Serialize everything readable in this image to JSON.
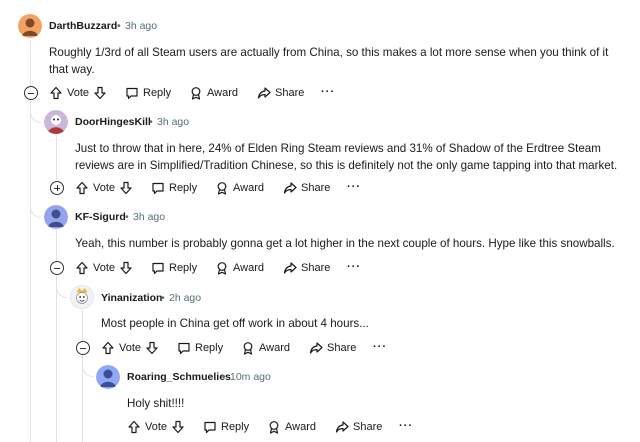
{
  "comments": [
    {
      "author": "DarthBuzzard",
      "time": "3h ago",
      "body": "Roughly 1/3rd of all Steam users are actually from China, so this makes a lot more sense when you think of it that way.",
      "collapsed": false,
      "avatar_color": "#f4a261"
    },
    {
      "author": "DoorHingesKill",
      "time": "3h ago",
      "body": "Just to throw that in here, 24% of Elden Ring Steam reviews and 31% of Shadow of the Erdtree Steam reviews are in Simplified/Tradition Chinese, so this is definitely not the only game tapping into that market.",
      "collapsed": true,
      "avatar_color": "#c9b8d9"
    },
    {
      "author": "KF-Sigurd",
      "time": "3h ago",
      "body": "Yeah, this number is probably gonna get a lot higher in the next couple of hours. Hype like this snowballs.",
      "collapsed": false,
      "avatar_color": "#94a3f0"
    },
    {
      "author": "Yinanization",
      "time": "2h ago",
      "body": "Most people in China get off work in about 4 hours...",
      "collapsed": false,
      "avatar_color": "#f2f2f2"
    },
    {
      "author": "Roaring_Schmuelies",
      "time": "10m ago",
      "body": "Holy shit!!!!",
      "collapsed": false,
      "avatar_color": "#8ea8f5"
    }
  ],
  "actions": {
    "vote": "Vote",
    "reply": "Reply",
    "award": "Award",
    "share": "Share",
    "more": "···"
  },
  "meta": {
    "dot": "•"
  },
  "icons": [
    "arrow-up-icon",
    "arrow-down-icon",
    "reply-bubble-icon",
    "award-icon",
    "share-icon",
    "more-icon",
    "collapse-icon",
    "expand-icon"
  ]
}
